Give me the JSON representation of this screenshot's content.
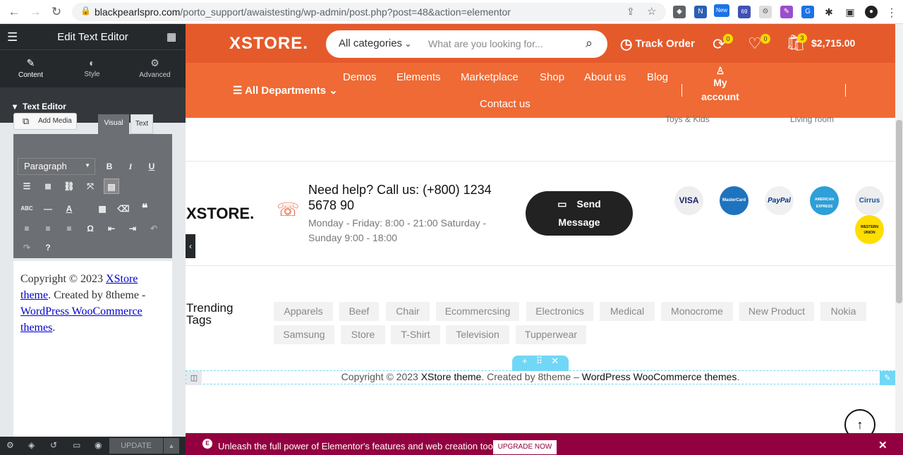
{
  "browser": {
    "host": "blackpearlspro.com",
    "path": "/porto_support/awaistesting/wp-admin/post.php?post=48&action=elementor",
    "badges": {
      "new": "New",
      "count": "69"
    }
  },
  "panel": {
    "title": "Edit Text Editor",
    "tabs": [
      {
        "label": "Content"
      },
      {
        "label": "Style"
      },
      {
        "label": "Advanced"
      }
    ],
    "section_title": "Text Editor",
    "add_media": "Add Media",
    "visual_tab": "Visual",
    "text_tab": "Text",
    "paragraph_select": "Paragraph",
    "editor": {
      "prefix": "Copyright © 2023 ",
      "link1": "XStore theme",
      "middle": ". Created by 8theme - ",
      "link2": "WordPress WooCommerce themes",
      "suffix": "."
    },
    "update": "UPDATE"
  },
  "header": {
    "logo": "XSTORE.",
    "category": "All categories",
    "search_placeholder": "What are you looking for...",
    "track_order": "Track Order",
    "compare_count": "0",
    "wishlist_count": "0",
    "cart_count": "3",
    "cart_total": "$2,715.00",
    "all_departments": "All Departments",
    "menu": [
      "Demos",
      "Elements",
      "Marketplace",
      "Shop",
      "About us",
      "Blog"
    ],
    "contact": "Contact us",
    "account_line1": "My",
    "account_line2": "account",
    "behind_left": "Toys & Kids",
    "behind_right": "Living room"
  },
  "footer": {
    "logo": "XSTORE.",
    "help_title": "Need help? Call us: (+800) 1234 5678 90",
    "help_hours": "Monday - Friday: 8:00 - 21:00 Saturday - Sunday 9:00 - 18:00",
    "send_line1": "Send",
    "send_line2": "Message",
    "payments": [
      "VISA",
      "MasterCard",
      "PayPal",
      "AMERICAN EXPRESS",
      "Cirrus",
      "WESTERN UNION"
    ],
    "trending_line1": "Trending",
    "trending_line2": "Tags",
    "tags": [
      "Apparels",
      "Beef",
      "Chair",
      "Ecommercsing",
      "Electronics",
      "Medical",
      "Monocrome",
      "New Product",
      "Nokia",
      "Samsung",
      "Store",
      "T-Shirt",
      "Television",
      "Tupperwear"
    ],
    "copyright_prefix": "Copyright © 2023 ",
    "copyright_brand": "XStore theme",
    "copyright_mid": ". Created by 8theme – ",
    "copyright_link": "WordPress WooCommerce themes",
    "copyright_suffix": "."
  },
  "promo": {
    "text": "Unleash the full power of Elementor's features and web creation tools.",
    "button": "UPGRADE NOW"
  },
  "colors": {
    "brand": "#e55a2b",
    "elementor_dark": "#26292c",
    "accent": "#71d7f7",
    "promo": "#93003f"
  }
}
